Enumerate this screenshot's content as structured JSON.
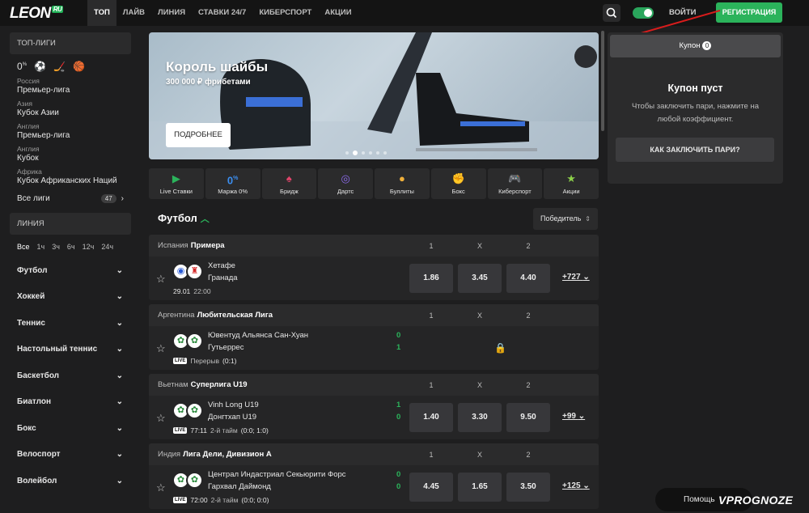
{
  "header": {
    "logo": "LEON",
    "logo_suffix": "RU",
    "nav": [
      "ТОП",
      "ЛАЙВ",
      "ЛИНИЯ",
      "СТАВКИ 24/7",
      "КИБЕРСПОРТ",
      "АКЦИИ"
    ],
    "login": "ВОЙТИ",
    "register": "РЕГИСТРАЦИЯ"
  },
  "sidebar": {
    "top_leagues_title": "ТОП-ЛИГИ",
    "leagues": [
      {
        "country": "Россия",
        "name": "Премьер-лига"
      },
      {
        "country": "Азия",
        "name": "Кубок Азии"
      },
      {
        "country": "Англия",
        "name": "Премьер-лига"
      },
      {
        "country": "Англия",
        "name": "Кубок"
      },
      {
        "country": "Африка",
        "name": "Кубок Африканских Наций"
      }
    ],
    "all_leagues": "Все лиги",
    "all_leagues_count": "47",
    "line_title": "ЛИНИЯ",
    "periods": [
      "Все",
      "1ч",
      "3ч",
      "6ч",
      "12ч",
      "24ч"
    ],
    "sports": [
      "Футбол",
      "Хоккей",
      "Теннис",
      "Настольный теннис",
      "Баскетбол",
      "Биатлон",
      "Бокс",
      "Велоспорт",
      "Волейбол"
    ]
  },
  "banner": {
    "title": "Король шайбы",
    "subtitle": "300 000 ₽ фрибетами",
    "button": "ПОДРОБНЕЕ"
  },
  "quick_links": [
    {
      "label": "Live Ставки",
      "icon": "play-icon"
    },
    {
      "label": "Маржа 0%",
      "icon": "zero-percent-icon"
    },
    {
      "label": "Бридж",
      "icon": "cards-icon"
    },
    {
      "label": "Дартс",
      "icon": "darts-icon"
    },
    {
      "label": "Буллиты",
      "icon": "puck-icon"
    },
    {
      "label": "Бокс",
      "icon": "boxing-glove-icon"
    },
    {
      "label": "Киберспорт",
      "icon": "gamepad-icon"
    },
    {
      "label": "Акции",
      "icon": "ticket-icon"
    }
  ],
  "section": {
    "title": "Футбол",
    "sort": "Победитель"
  },
  "odds_headers": [
    "1",
    "X",
    "2"
  ],
  "matches": [
    {
      "country": "Испания",
      "league": "Примера",
      "team1": "Хетафе",
      "team2": "Гранада",
      "date": "29.01",
      "time": "22:00",
      "odds": [
        "1.86",
        "3.45",
        "4.40"
      ],
      "more": "+727"
    },
    {
      "country": "Аргентина",
      "league": "Любительская Лига",
      "team1": "Ювентуд Альянса Сан-Хуан",
      "team2": "Гутьеррес",
      "score1": "0",
      "score2": "1",
      "live": "LIVE",
      "status": "Перерыв",
      "extra": "(0:1)"
    },
    {
      "country": "Вьетнам",
      "league": "Суперлига U19",
      "team1": "Vinh Long U19",
      "team2": "Донгтхап U19",
      "score1": "1",
      "score2": "0",
      "live": "LIVE",
      "clock": "77:11",
      "status": "2-й тайм",
      "extra": "(0:0; 1:0)",
      "odds": [
        "1.40",
        "3.30",
        "9.50"
      ],
      "more": "+99"
    },
    {
      "country": "Индия",
      "league": "Лига Дели, Дивизион А",
      "team1": "Централ Индастриал Секьюрити Форс",
      "team2": "Гархвал Даймонд",
      "score1": "0",
      "score2": "0",
      "live": "LIVE",
      "clock": "72:00",
      "status": "2-й тайм",
      "extra": "(0:0; 0:0)",
      "odds": [
        "4.45",
        "1.65",
        "3.50"
      ],
      "more": "+125"
    }
  ],
  "coupon": {
    "tab": "Купон",
    "count": "0",
    "title": "Купон пуст",
    "text": "Чтобы заключить пари, нажмите на любой коэффициент.",
    "button": "КАК ЗАКЛЮЧИТЬ ПАРИ?"
  },
  "help": "Помощь",
  "watermark": "VPROGNOZE",
  "colors": {
    "accent": "#2bb35b",
    "bg": "#1e1e1f",
    "panel": "#2b2b2c"
  }
}
